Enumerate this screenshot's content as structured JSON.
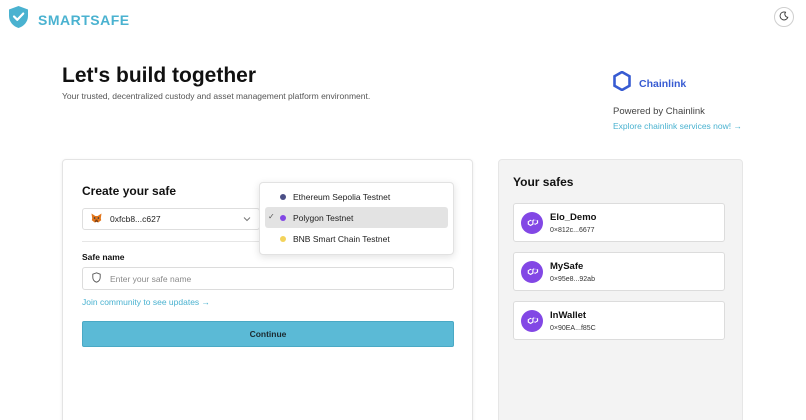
{
  "header": {
    "brand": "SMARTSAFE",
    "logo_icon": "shield-check-icon",
    "theme_icon": "moon-icon"
  },
  "hero": {
    "title": "Let's build together",
    "subtitle": "Your trusted, decentralized custody and asset management platform environment."
  },
  "chainlink": {
    "name": "Chainlink",
    "powered_by": "Powered by Chainlink",
    "explore_link": "Explore chainlink services now! →"
  },
  "create_safe": {
    "title": "Create your safe",
    "wallet_address": "0xfcb8...c627",
    "safe_name_label": "Safe name",
    "safe_name_placeholder": "Enter your safe name",
    "safe_name_value": "",
    "community_link": "Join community to see updates →",
    "continue_label": "Continue"
  },
  "network_dropdown": {
    "selected": "Polygon Testnet",
    "options": [
      {
        "label": "Ethereum Sepolia Testnet",
        "color": "#4b4f86"
      },
      {
        "label": "Polygon Testnet",
        "color": "#8247e5"
      },
      {
        "label": "BNB Smart Chain Testnet",
        "color": "#f3d35b"
      }
    ]
  },
  "safes": {
    "title": "Your safes",
    "items": [
      {
        "name": "Elo_Demo",
        "address": "0×812c...6677"
      },
      {
        "name": "MySafe",
        "address": "0×95e8...92ab"
      },
      {
        "name": "InWallet",
        "address": "0×90EA...f85C"
      }
    ]
  },
  "colors": {
    "accent": "#4ab2d0",
    "button": "#5bbad6",
    "chainlink_blue": "#375bd2",
    "polygon_purple": "#8247e5"
  }
}
